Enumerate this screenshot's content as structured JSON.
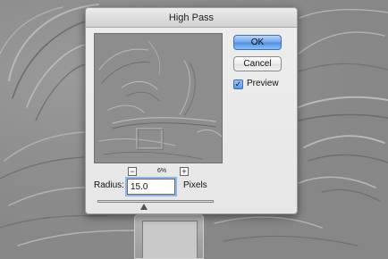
{
  "dialog": {
    "title": "High Pass",
    "ok_label": "OK",
    "cancel_label": "Cancel",
    "preview_label": "Preview",
    "preview_checked": true,
    "zoom_out_symbol": "−",
    "zoom_in_symbol": "+",
    "zoom_level": "6%",
    "radius_label": "Radius:",
    "radius_value": "15.0",
    "radius_unit": "Pixels",
    "radius_slider_fraction": 0.4
  },
  "colors": {
    "accent_button": "#6ea6ea",
    "dialog_background": "#e8e8e8",
    "backdrop_gray": "#8b8b8b"
  },
  "icons": {
    "zoom_out": "minus-icon",
    "zoom_in": "plus-icon",
    "checkbox": "checkmark-icon"
  }
}
